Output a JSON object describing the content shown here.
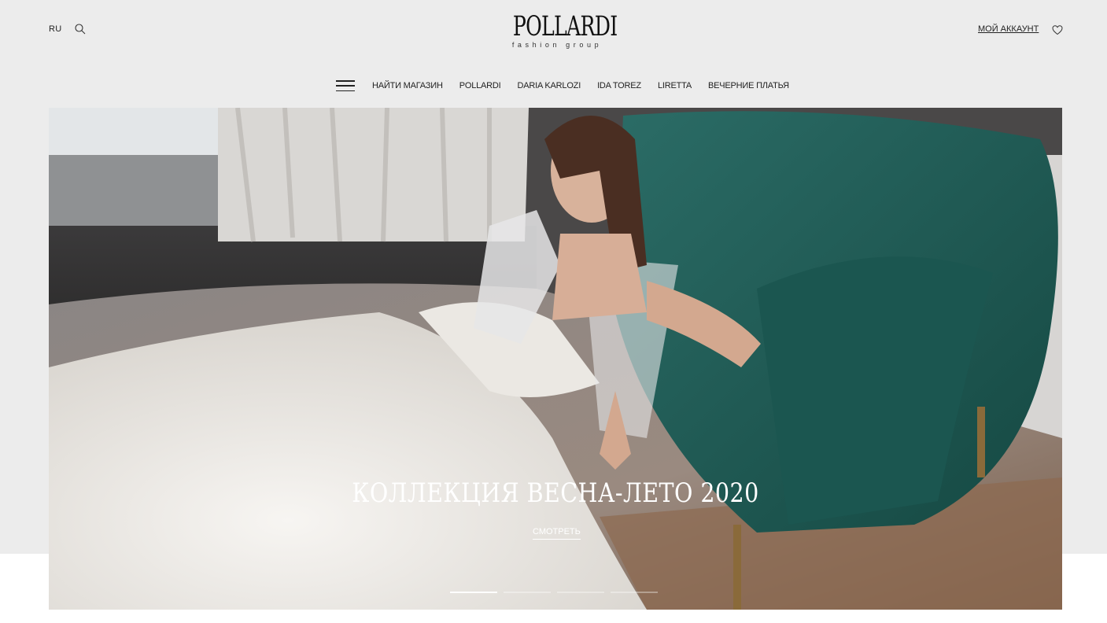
{
  "header": {
    "lang": "RU",
    "logo_main": "POLLARDI",
    "logo_sub": "fashion group",
    "account": "МОЙ АККАУНТ"
  },
  "nav": {
    "items": [
      {
        "label": "НАЙТИ МАГАЗИН"
      },
      {
        "label": "POLLARDI"
      },
      {
        "label": "DARIA KARLOZI"
      },
      {
        "label": "IDA TOREZ"
      },
      {
        "label": "LIRETTA"
      },
      {
        "label": "ВЕЧЕРНИЕ ПЛАТЬЯ"
      }
    ]
  },
  "hero": {
    "title": "КОЛЛЕКЦИЯ ВЕСНА-ЛЕТО 2020",
    "cta": "СМОТРЕТЬ",
    "slides_total": 4,
    "active_slide": 1
  },
  "icons": [
    "search-icon",
    "heart-icon",
    "menu-icon"
  ],
  "colors": {
    "page_bg": "#ececec",
    "chair_teal": "#1f5d57",
    "text": "#222222"
  }
}
